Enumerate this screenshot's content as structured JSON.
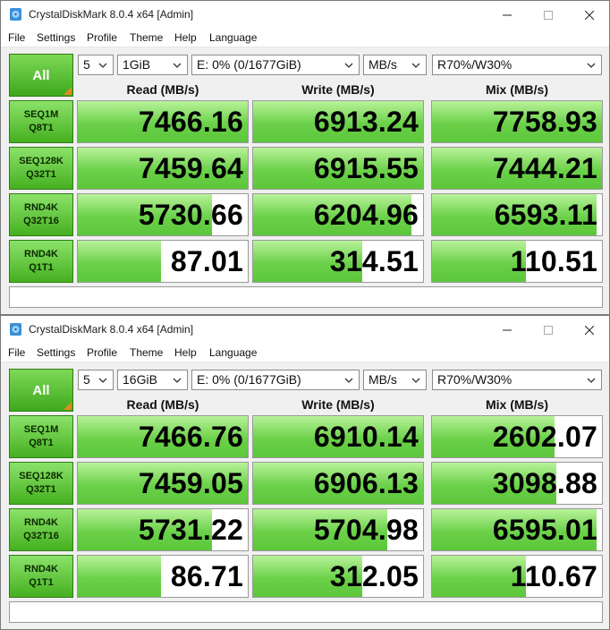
{
  "colors": {
    "accent_green": "#4cbb17",
    "corner_orange": "#e08a1e"
  },
  "windows": [
    {
      "title": "CrystalDiskMark 8.0.4 x64 [Admin]",
      "menu": [
        "File",
        "Settings",
        "Profile",
        "Theme",
        "Help",
        "Language"
      ],
      "all_label": "All",
      "count": "5",
      "size": "1GiB",
      "drive": "E: 0% (0/1677GiB)",
      "unit": "MB/s",
      "mix": "R70%/W30%",
      "headers": {
        "read": "Read (MB/s)",
        "write": "Write (MB/s)",
        "mix": "Mix (MB/s)"
      },
      "rows": [
        {
          "l1": "SEQ1M",
          "l2": "Q8T1",
          "read": "7466.16",
          "write": "6913.24",
          "mix": "7758.93",
          "read_fill": 1.0,
          "write_fill": 1.0,
          "mix_fill": 1.0
        },
        {
          "l1": "SEQ128K",
          "l2": "Q32T1",
          "read": "7459.64",
          "write": "6915.55",
          "mix": "7444.21",
          "read_fill": 1.0,
          "write_fill": 1.0,
          "mix_fill": 1.0
        },
        {
          "l1": "RND4K",
          "l2": "Q32T16",
          "read": "5730.66",
          "write": "6204.96",
          "mix": "6593.11",
          "read_fill": 0.79,
          "write_fill": 0.93,
          "mix_fill": 0.97
        },
        {
          "l1": "RND4K",
          "l2": "Q1T1",
          "read": "87.01",
          "write": "314.51",
          "mix": "110.51",
          "read_fill": 0.49,
          "write_fill": 0.64,
          "mix_fill": 0.55
        }
      ],
      "comment": ""
    },
    {
      "title": "CrystalDiskMark 8.0.4 x64 [Admin]",
      "menu": [
        "File",
        "Settings",
        "Profile",
        "Theme",
        "Help",
        "Language"
      ],
      "all_label": "All",
      "count": "5",
      "size": "16GiB",
      "drive": "E: 0% (0/1677GiB)",
      "unit": "MB/s",
      "mix": "R70%/W30%",
      "headers": {
        "read": "Read (MB/s)",
        "write": "Write (MB/s)",
        "mix": "Mix (MB/s)"
      },
      "rows": [
        {
          "l1": "SEQ1M",
          "l2": "Q8T1",
          "read": "7466.76",
          "write": "6910.14",
          "mix": "2602.07",
          "read_fill": 1.0,
          "write_fill": 1.0,
          "mix_fill": 0.72
        },
        {
          "l1": "SEQ128K",
          "l2": "Q32T1",
          "read": "7459.05",
          "write": "6906.13",
          "mix": "3098.88",
          "read_fill": 1.0,
          "write_fill": 1.0,
          "mix_fill": 0.73
        },
        {
          "l1": "RND4K",
          "l2": "Q32T16",
          "read": "5731.22",
          "write": "5704.98",
          "mix": "6595.01",
          "read_fill": 0.79,
          "write_fill": 0.79,
          "mix_fill": 0.97
        },
        {
          "l1": "RND4K",
          "l2": "Q1T1",
          "read": "86.71",
          "write": "312.05",
          "mix": "110.67",
          "read_fill": 0.49,
          "write_fill": 0.64,
          "mix_fill": 0.55
        }
      ],
      "comment": ""
    }
  ]
}
